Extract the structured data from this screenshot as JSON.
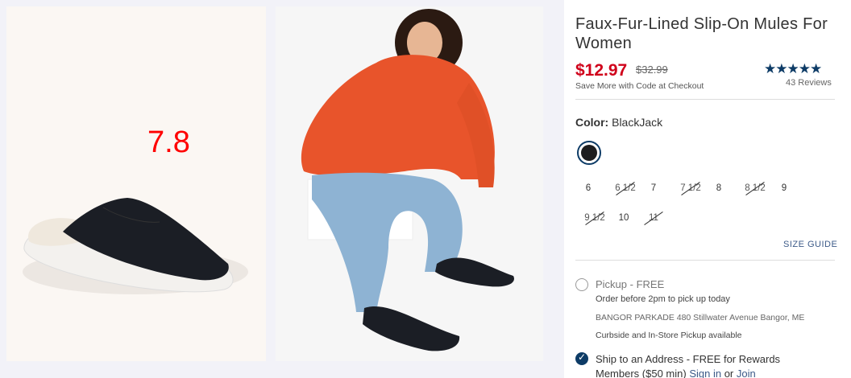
{
  "overlay": {
    "number": "7.8"
  },
  "product": {
    "title": "Faux-Fur-Lined Slip-On Mules For Women",
    "price": "$12.97",
    "old_price": "$32.99",
    "promo": "Save More with Code at Checkout",
    "rating_stars": "★★★★★",
    "rating_value": 4.5,
    "reviews": "43 Reviews"
  },
  "color": {
    "label": "Color:",
    "value": "BlackJack",
    "swatch_hex": "#1d1d1f"
  },
  "sizes": [
    {
      "label": "6",
      "available": true
    },
    {
      "label": "6 1/2",
      "available": false
    },
    {
      "label": "7",
      "available": true
    },
    {
      "label": "7 1/2",
      "available": false
    },
    {
      "label": "8",
      "available": true
    },
    {
      "label": "8 1/2",
      "available": false
    },
    {
      "label": "9",
      "available": true
    },
    {
      "label": "9 1/2",
      "available": false
    },
    {
      "label": "10",
      "available": true
    },
    {
      "label": "11",
      "available": false
    }
  ],
  "size_guide": "SIZE GUIDE",
  "fulfillment": {
    "pickup_title": "Pickup - FREE",
    "pickup_note": "Order before 2pm to pick up today",
    "store": "BANGOR PARKADE 480 Stillwater Avenue Bangor, ME",
    "curbside": "Curbside and In-Store Pickup available",
    "ship_title": "Ship to an Address - FREE for Rewards",
    "ship_sub_prefix": "Members ($50 min)",
    "sign_in": "Sign in",
    "or": "or",
    "join": "Join"
  },
  "colors": {
    "accent": "#0d3b66",
    "price": "#d0021b",
    "overlay": "#ff0000"
  }
}
